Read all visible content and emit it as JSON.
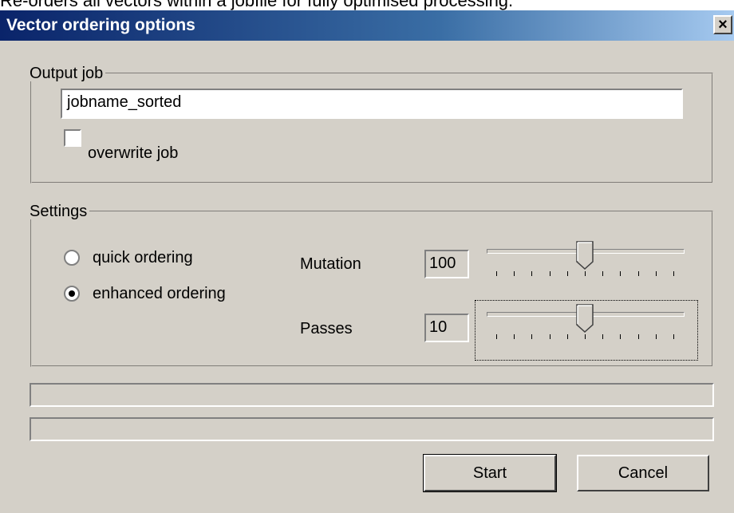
{
  "caption": "Re-orders all vectors within a jobfile for fully optimised processing.",
  "window": {
    "title": "Vector ordering options",
    "close_glyph": "×"
  },
  "output_group": {
    "legend": "Output job",
    "job_name_value": "jobname_sorted",
    "overwrite_label": "overwrite job",
    "overwrite_checked": false
  },
  "settings_group": {
    "legend": "Settings",
    "ordering_options": [
      {
        "label": "quick ordering",
        "selected": false
      },
      {
        "label": "enhanced ordering",
        "selected": true
      }
    ],
    "mutation": {
      "label": "Mutation",
      "value": "100",
      "slider_fraction": 0.5
    },
    "passes": {
      "label": "Passes",
      "value": "10",
      "slider_fraction": 0.5
    }
  },
  "progress_bars": [
    {
      "fraction": 0
    },
    {
      "fraction": 0
    }
  ],
  "buttons": {
    "start_label": "Start",
    "cancel_label": "Cancel"
  },
  "icons": {
    "close": "close-icon",
    "slider_thumb": "slider-thumb-icon"
  }
}
